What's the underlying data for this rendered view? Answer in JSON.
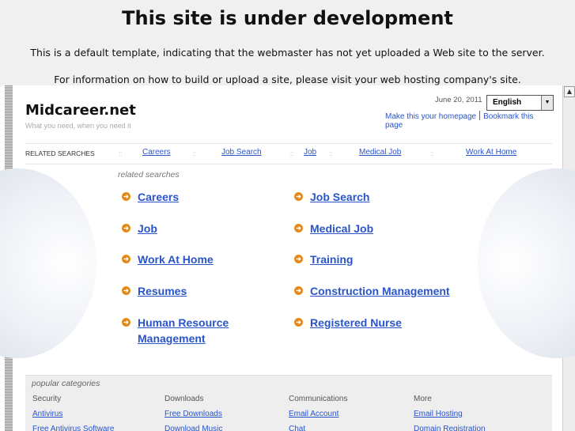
{
  "notice": {
    "title": "This site is under development",
    "line1": "This is a default template, indicating that the webmaster has not yet uploaded a Web site to the server.",
    "line2": "For information on how to build or upload a site, please visit your web hosting company's site."
  },
  "site": {
    "name": "Midcareer.net",
    "tagline": "What you need, when you need it",
    "date": "June 20, 2011",
    "language": "English",
    "homepage_link": "Make this your homepage",
    "bookmark_link": "Bookmark this page"
  },
  "related_bar": {
    "label": "RELATED SEARCHES",
    "separator": "::",
    "links": [
      "Careers",
      "Job Search",
      "Job",
      "Medical Job",
      "Work At Home"
    ]
  },
  "related": {
    "heading": "related searches",
    "left": [
      "Careers",
      "Job",
      "Work At Home",
      "Resumes",
      "Human Resource Management"
    ],
    "right": [
      "Job Search",
      "Medical Job",
      "Training",
      "Construction Management",
      "Registered Nurse"
    ]
  },
  "popular": {
    "heading": "popular categories",
    "columns": [
      {
        "title": "Security",
        "links": [
          "Antivirus",
          "Free Antivirus Software"
        ]
      },
      {
        "title": "Downloads",
        "links": [
          "Free Downloads",
          "Download Music"
        ]
      },
      {
        "title": "Communications",
        "links": [
          "Email Account",
          "Chat"
        ]
      },
      {
        "title": "More",
        "links": [
          "Email Hosting",
          "Domain Registration"
        ]
      }
    ]
  },
  "icons": {
    "bullet": "arrow-circle-icon",
    "scroll_up": "scroll-up-arrow-icon",
    "dropdown": "chevron-down-icon"
  },
  "colors": {
    "link": "#2a55c8",
    "bullet": "#e38a1a"
  }
}
